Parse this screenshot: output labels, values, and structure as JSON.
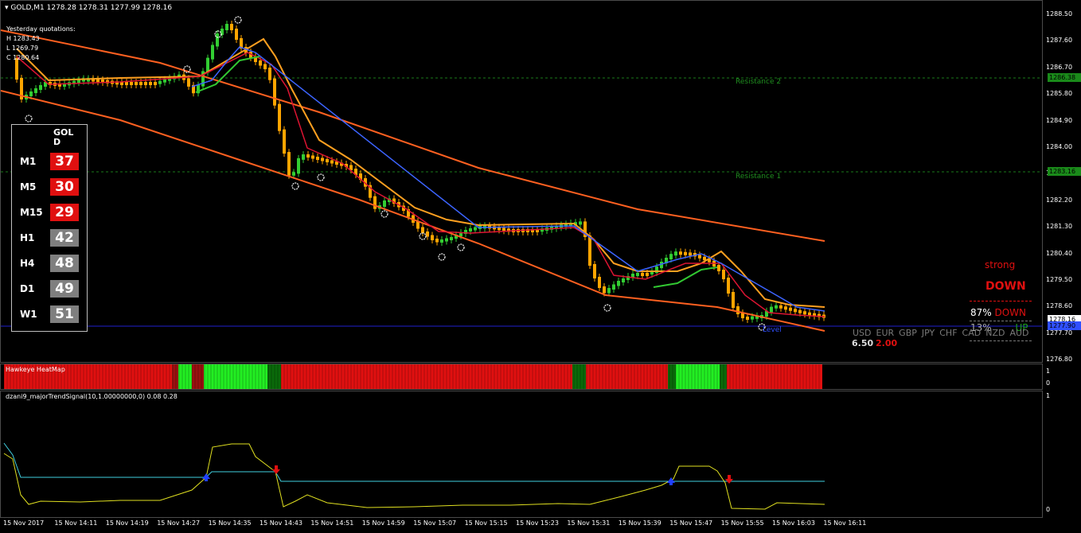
{
  "header": {
    "symbol_info": "GOLD,M1  1278.28 1278.31 1277.99 1278.16"
  },
  "yesterday": {
    "title": "Yesterday quotations:",
    "h": "H 1283.43",
    "l": "L 1269.79",
    "c": "C 1280.64"
  },
  "price_axis": [
    "1288.50",
    "1287.60",
    "1286.70",
    "1285.80",
    "1284.90",
    "1284.00",
    "1283.10",
    "1282.20",
    "1281.30",
    "1280.40",
    "1279.50",
    "1278.60",
    "1277.70",
    "1276.80"
  ],
  "badges": {
    "resistance2": "1286.38",
    "resistance1": "1283.16",
    "current": "1278.16",
    "current_low": "1277.90"
  },
  "levels": {
    "resistance2": "Resistance 2",
    "resistance1": "Resistance 1",
    "pivot": "Level"
  },
  "timeframes": {
    "symbol": "GOLD",
    "rows": [
      {
        "tf": "M1",
        "value": "37",
        "color": "#e01010"
      },
      {
        "tf": "M5",
        "value": "30",
        "color": "#e01010"
      },
      {
        "tf": "M15",
        "value": "29",
        "color": "#e01010"
      },
      {
        "tf": "H1",
        "value": "42",
        "color": "#7f7f7f"
      },
      {
        "tf": "H4",
        "value": "48",
        "color": "#7f7f7f"
      },
      {
        "tf": "D1",
        "value": "49",
        "color": "#7f7f7f"
      },
      {
        "tf": "W1",
        "value": "51",
        "color": "#7f7f7f"
      }
    ]
  },
  "signal": {
    "strength": "strong",
    "direction": "DOWN",
    "down_pct": "87%",
    "down_label": "DOWN",
    "up_pct": "13%",
    "up_label": "UP"
  },
  "currencies": {
    "labels": [
      "USD",
      "EUR",
      "GBP",
      "JPY",
      "CHF",
      "CAD",
      "NZD",
      "AUD"
    ],
    "value1": "6.50",
    "value2": "2.00"
  },
  "heatmap": {
    "title": "Hawkeye HeatMap",
    "axis_top": "1",
    "axis_bottom": "0"
  },
  "oscillator": {
    "title": "dzani9_majorTrendSignal(10,1.00000000,0) 0.08 0.28",
    "axis_top": "1",
    "axis_bottom": "0"
  },
  "time_axis": [
    "15 Nov 2017",
    "15 Nov 14:11",
    "15 Nov 14:19",
    "15 Nov 14:27",
    "15 Nov 14:35",
    "15 Nov 14:43",
    "15 Nov 14:51",
    "15 Nov 14:59",
    "15 Nov 15:07",
    "15 Nov 15:15",
    "15 Nov 15:23",
    "15 Nov 15:31",
    "15 Nov 15:39",
    "15 Nov 15:47",
    "15 Nov 15:55",
    "15 Nov 16:03",
    "15 Nov 16:11"
  ],
  "colors": {
    "bull": "#32cd32",
    "bear": "#ffa500",
    "ma_slow": "#ff6020",
    "ma_mid": "#ffa020",
    "ma_fast": "#dc1432",
    "ma_blue": "#3c64ff",
    "ma_green": "#32c832",
    "heat_red": "#e01010",
    "heat_green": "#22ee22"
  }
}
